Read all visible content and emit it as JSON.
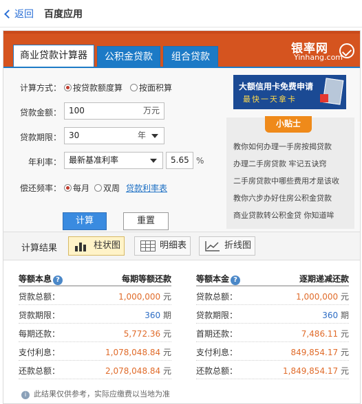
{
  "topbar": {
    "back_label": "返回",
    "title": "百度应用"
  },
  "tabs": [
    {
      "label": "商业贷款计算器",
      "active": true
    },
    {
      "label": "公积金贷款",
      "active": false
    },
    {
      "label": "组合贷款",
      "active": false
    }
  ],
  "logo": {
    "cn": "银率网",
    "en": "Yinhang.com"
  },
  "form": {
    "calc_method_label": "计算方式：",
    "calc_method_options": [
      "按贷款额度算",
      "按面积算"
    ],
    "loan_amount_label": "贷款金额：",
    "loan_amount_value": "100",
    "loan_amount_unit": "万元",
    "loan_term_label": "贷款期限：",
    "loan_term_value": "30",
    "loan_term_unit": "年",
    "rate_label": "年利率：",
    "rate_select": "最新基准利率",
    "rate_value": "5.65",
    "rate_unit": "%",
    "repay_freq_label": "偿还频率：",
    "repay_freq_options": [
      "每月",
      "双周"
    ],
    "rate_table_link": "贷款利率表",
    "calc_button": "计算",
    "reset_button": "重置"
  },
  "banner": {
    "line1": "大额信用卡免费申请",
    "line2": "最快一天拿卡"
  },
  "tips": {
    "title": "小贴士",
    "items": [
      "教你如何办理一手房按揭贷款",
      "办理二手房贷款 牢记五诀窍",
      "二手房贷款中哪些费用才是该收",
      "教你六步办好住房公积金贷款",
      "商业贷款转公积金贷 你知道哞"
    ]
  },
  "results": {
    "title": "计算结果",
    "views": [
      "柱状图",
      "明细表",
      "折线图"
    ],
    "equal_payment": {
      "header_left": "等额本息",
      "header_right": "每期等额还款",
      "rows": [
        {
          "key": "贷款总额：",
          "value": "1,000,000",
          "unit": "元"
        },
        {
          "key": "贷款期限：",
          "value": "360",
          "unit": "期"
        },
        {
          "key": "每期还款：",
          "value": "5,772.36",
          "unit": "元"
        },
        {
          "key": "支付利息：",
          "value": "1,078,048.84",
          "unit": "元"
        },
        {
          "key": "还款总额：",
          "value": "2,078,048.84",
          "unit": "元"
        }
      ]
    },
    "equal_principal": {
      "header_left": "等额本金",
      "header_right": "逐期递减还款",
      "rows": [
        {
          "key": "贷款总额：",
          "value": "1,000,000",
          "unit": "元"
        },
        {
          "key": "贷款期限：",
          "value": "360",
          "unit": "期"
        },
        {
          "key": "首期还款：",
          "value": "7,486.11",
          "unit": "元"
        },
        {
          "key": "支付利息：",
          "value": "849,854.17",
          "unit": "元"
        },
        {
          "key": "还款总额：",
          "value": "1,849,854.17",
          "unit": "元"
        }
      ]
    },
    "note": "此结果仅供参考，实际应缴费以当地为准"
  },
  "colors": {
    "brand_orange": "#d5541f",
    "tab_blue": "#1c7ac6",
    "value_orange": "#e06b2a",
    "value_blue": "#2c6cc4"
  }
}
